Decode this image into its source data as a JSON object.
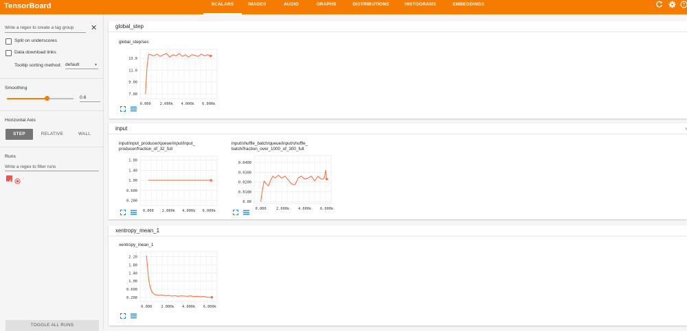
{
  "app": {
    "title": "TensorBoard"
  },
  "nav": {
    "tabs": [
      {
        "label": "SCALARS",
        "active": true
      },
      {
        "label": "IMAGES"
      },
      {
        "label": "AUDIO"
      },
      {
        "label": "GRAPHS"
      },
      {
        "label": "DISTRIBUTIONS"
      },
      {
        "label": "HISTOGRAMS"
      },
      {
        "label": "EMBEDDINGS"
      }
    ],
    "icons": [
      "refresh-icon",
      "settings-icon",
      "help-icon"
    ]
  },
  "sidebar": {
    "tag_regex_placeholder": "Write a regex to create a tag group",
    "split_label": "Split on underscores",
    "download_label": "Data download links",
    "tooltip_label": "Tooltip sorting method:",
    "tooltip_value": "default",
    "smoothing_label": "Smoothing",
    "smoothing_value": "0.6",
    "smoothing": 0.6,
    "axis_label": "Horizontal Axis",
    "axis_options": [
      "STEP",
      "RELATIVE",
      "WALL"
    ],
    "runs_label": "Runs",
    "runs_filter_placeholder": "Write a regex to filter runs",
    "run_name": ".",
    "toggle_label": "TOGGLE ALL RUNS"
  },
  "accent": "#f57c00",
  "line_color": "#ff7043",
  "groups": [
    {
      "title": "global_step"
    },
    {
      "title": "input"
    },
    {
      "title": "xentropy_mean_1"
    }
  ],
  "cards": [
    {
      "title": "global_step/sec"
    },
    {
      "title_line1": "input/input_producer/queue/input/input_",
      "title_line2": "producer/fraction_of_32_full"
    },
    {
      "title_line1": "input/shuffle_batch/queue/input/shuffle_",
      "title_line2": "batch/fraction_over_1000_of_300_full"
    },
    {
      "title": "xentropy_mean_1"
    }
  ],
  "chart_data": [
    {
      "type": "line",
      "title": "global_step/sec",
      "x_ticks": [
        "0.000",
        "2.000k",
        "4.000k",
        "6.000k"
      ],
      "y_ticks": [
        "7.00",
        "9.00",
        "11.0",
        "13.0"
      ],
      "xlim": [
        -500,
        6800
      ],
      "ylim": [
        6.2,
        14.5
      ],
      "series": [
        {
          "x": [
            0,
            150,
            300,
            500,
            800,
            1100,
            1400,
            1700,
            2000,
            2300,
            2600,
            2900,
            3200,
            3500,
            3800,
            4100,
            4400,
            4700,
            5000,
            5300,
            5600,
            5900,
            6200
          ],
          "y": [
            7.0,
            11.5,
            13.7,
            13.6,
            13.4,
            13.7,
            13.3,
            13.6,
            13.8,
            13.2,
            13.6,
            13.4,
            13.8,
            13.3,
            13.6,
            13.2,
            13.6,
            13.5,
            13.3,
            13.7,
            13.4,
            13.6,
            13.4
          ]
        }
      ]
    },
    {
      "type": "line",
      "title": "input/input_producer/queue/input/input_producer/fraction_of_32_full",
      "x_ticks": [
        "0.000",
        "2.000k",
        "4.000k",
        "6.000k"
      ],
      "y_ticks": [
        "0.200",
        "0.600",
        "1.00",
        "1.40",
        "1.80"
      ],
      "xlim": [
        -800,
        6800
      ],
      "ylim": [
        0,
        1.95
      ],
      "series": [
        {
          "x": [
            0,
            1000,
            2000,
            3000,
            4000,
            5000,
            6200
          ],
          "y": [
            1.0,
            1.0,
            1.0,
            1.0,
            1.0,
            1.0,
            1.0
          ]
        }
      ]
    },
    {
      "type": "line",
      "title": "input/shuffle_batch/queue/input/shuffle_batch/fraction_over_1000_of_300_full",
      "x_ticks": [
        "0.000",
        "2.000k",
        "4.000k",
        "6.000k"
      ],
      "y_ticks": [
        "0.00",
        "0.0100",
        "0.0200",
        "0.0300",
        "0.0400"
      ],
      "xlim": [
        -600,
        6400
      ],
      "ylim": [
        -0.002,
        0.047
      ],
      "series": [
        {
          "x": [
            0,
            150,
            300,
            500,
            700,
            900,
            1100,
            1300,
            1600,
            1900,
            2200,
            2500,
            2800,
            3100,
            3400,
            3700,
            4000,
            4300,
            4600,
            4900,
            5200,
            5500,
            5700,
            5800,
            5900,
            6000
          ],
          "y": [
            0.0,
            0.012,
            0.021,
            0.018,
            0.016,
            0.022,
            0.026,
            0.024,
            0.027,
            0.024,
            0.026,
            0.022,
            0.018,
            0.017,
            0.024,
            0.026,
            0.023,
            0.024,
            0.026,
            0.021,
            0.026,
            0.023,
            0.023,
            0.025,
            0.032,
            0.023
          ]
        }
      ]
    },
    {
      "type": "line",
      "title": "xentropy_mean_1",
      "x_ticks": [
        "0.000",
        "2.000k",
        "4.000k",
        "6.000k"
      ],
      "y_ticks": [
        "0.200",
        "0.600",
        "1.00",
        "1.40",
        "1.80",
        "2.20"
      ],
      "xlim": [
        -600,
        6700
      ],
      "ylim": [
        0,
        2.45
      ],
      "series": [
        {
          "x": [
            0,
            100,
            200,
            350,
            500,
            700,
            900,
            1200,
            1500,
            1800,
            2100,
            2400,
            2700,
            3000,
            3300,
            3600,
            3900,
            4200,
            4500,
            4800,
            5100,
            5400,
            5700,
            6000,
            6200
          ],
          "y": [
            2.25,
            1.7,
            1.1,
            0.7,
            0.48,
            0.38,
            0.33,
            0.3,
            0.32,
            0.28,
            0.3,
            0.27,
            0.29,
            0.26,
            0.28,
            0.27,
            0.26,
            0.28,
            0.24,
            0.26,
            0.23,
            0.25,
            0.22,
            0.2,
            0.21
          ]
        }
      ]
    }
  ]
}
